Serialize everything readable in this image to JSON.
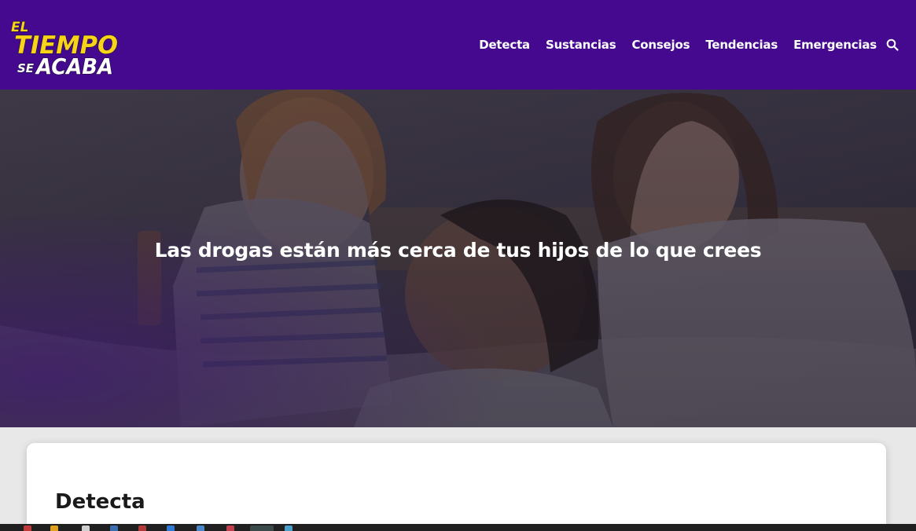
{
  "brand": {
    "logo_line1": "EL",
    "logo_line2": "TIEMPO",
    "logo_line3_a": "SE",
    "logo_line3_b": "ACABA",
    "logo_color": "#f7d417",
    "header_color": "#45098f"
  },
  "nav": {
    "items": [
      "Detecta",
      "Sustancias",
      "Consejos",
      "Tendencias",
      "Emergencias"
    ],
    "search_icon": "search-icon"
  },
  "hero": {
    "title": "Las drogas están más cerca de tus hijos de lo que crees"
  },
  "section": {
    "title": "Detecta"
  },
  "taskbar": {
    "icons": [
      "app-icon",
      "app-icon",
      "app-icon",
      "app-icon",
      "app-icon",
      "app-icon",
      "app-icon",
      "app-icon",
      "app-icon",
      "app-icon"
    ]
  }
}
